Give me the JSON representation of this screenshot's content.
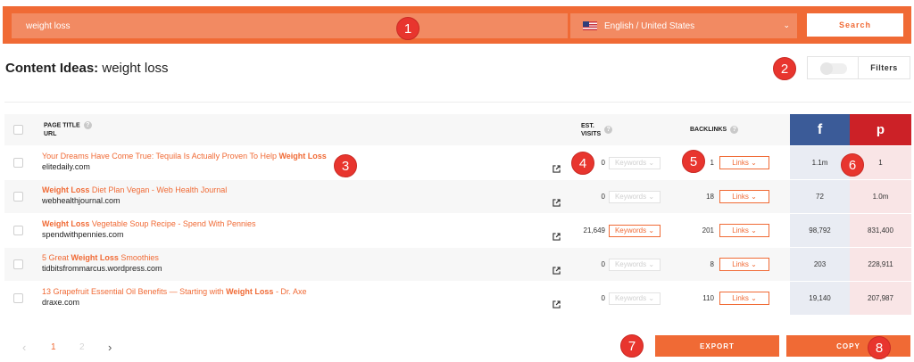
{
  "search": {
    "value": "weight loss",
    "language": "English / United States",
    "language_chevron": "⌄",
    "button": "Search"
  },
  "header": {
    "title_prefix": "Content Ideas:",
    "title_query": "weight loss",
    "filters_label": "Filters"
  },
  "table": {
    "col_title": "PAGE TITLE",
    "col_url": "URL",
    "col_visits_1": "EST.",
    "col_visits_2": "VISITS",
    "col_backlinks": "BACKLINKS",
    "facebook_glyph": "f",
    "pinterest_glyph": "p",
    "rows": [
      {
        "pre": "Your Dreams Have Come True: Tequila Is Actually Proven To Help ",
        "kw": "Weight Loss",
        "post": "",
        "domain": "elitedaily.com",
        "visits": "0",
        "keywords": "Keywords ⌄",
        "kw_active": false,
        "backlinks": "1",
        "links": "Links ⌄",
        "facebook": "1.1m",
        "pinterest": "1"
      },
      {
        "pre": "",
        "kw": "Weight Loss",
        "post": " Diet Plan Vegan - Web Health Journal",
        "domain": "webhealthjournal.com",
        "visits": "0",
        "keywords": "Keywords ⌄",
        "kw_active": false,
        "backlinks": "18",
        "links": "Links ⌄",
        "facebook": "72",
        "pinterest": "1.0m"
      },
      {
        "pre": "",
        "kw": "Weight Loss",
        "post": " Vegetable Soup Recipe - Spend With Pennies",
        "domain": "spendwithpennies.com",
        "visits": "21,649",
        "keywords": "Keywords ⌄",
        "kw_active": true,
        "backlinks": "201",
        "links": "Links ⌄",
        "facebook": "98,792",
        "pinterest": "831,400"
      },
      {
        "pre": "5 Great ",
        "kw": "Weight Loss",
        "post": " Smoothies",
        "domain": "tidbitsfrommarcus.wordpress.com",
        "visits": "0",
        "keywords": "Keywords ⌄",
        "kw_active": false,
        "backlinks": "8",
        "links": "Links ⌄",
        "facebook": "203",
        "pinterest": "228,911"
      },
      {
        "pre": "13 Grapefruit Essential Oil Benefits — Starting with ",
        "kw": "Weight Loss",
        "post": " - Dr. Axe",
        "domain": "draxe.com",
        "visits": "0",
        "keywords": "Keywords ⌄",
        "kw_active": false,
        "backlinks": "110",
        "links": "Links ⌄",
        "facebook": "19,140",
        "pinterest": "207,987"
      }
    ]
  },
  "pagination": {
    "prev": "‹",
    "page_1": "1",
    "page_2": "2",
    "next": "›"
  },
  "actions": {
    "export": "EXPORT",
    "copy": "COPY"
  },
  "markers": [
    "1",
    "2",
    "3",
    "4",
    "5",
    "6",
    "7",
    "8"
  ],
  "colors": {
    "accent": "#f06a35",
    "facebook": "#3b5b98",
    "pinterest": "#cc2127",
    "marker": "#e8352e"
  }
}
